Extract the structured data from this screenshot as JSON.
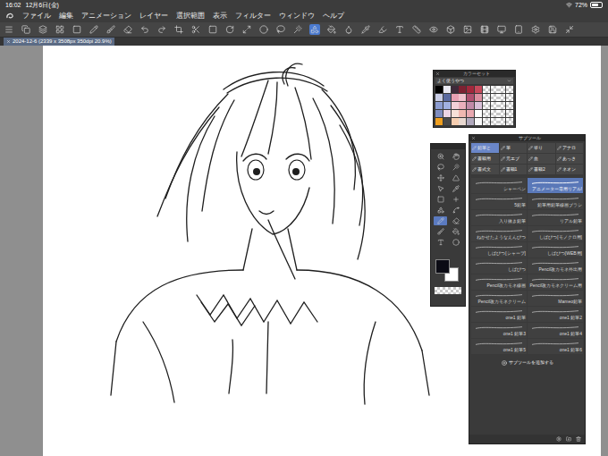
{
  "status_bar": {
    "time": "16:02",
    "date": "12月6日(金)",
    "battery": "72%",
    "battery_level": 0.72
  },
  "menu": [
    "ファイル",
    "編集",
    "アニメーション",
    "レイヤー",
    "選択範囲",
    "表示",
    "フィルター",
    "ウィンドウ",
    "ヘルプ"
  ],
  "toolbar": [
    {
      "selected": false
    },
    {
      "selected": false
    },
    {
      "selected": false
    },
    {
      "selected": false
    },
    {
      "selected": false
    },
    {
      "selected": false
    },
    {
      "selected": false
    },
    {
      "selected": false
    },
    {
      "selected": false
    },
    {
      "selected": false
    },
    {
      "selected": false
    },
    {
      "selected": false
    },
    {
      "selected": false
    },
    {
      "selected": false
    },
    {
      "selected": false
    },
    {
      "selected": false
    },
    {
      "selected": false
    },
    {
      "selected": false
    },
    {
      "selected": true
    },
    {
      "selected": false
    },
    {
      "selected": false
    },
    {
      "selected": false
    },
    {
      "selected": false
    },
    {
      "selected": false
    },
    {
      "selected": false
    },
    {
      "selected": false
    },
    {
      "selected": false
    },
    {
      "selected": false
    },
    {
      "selected": false
    },
    {
      "selected": false
    },
    {
      "selected": false
    },
    {
      "selected": false
    },
    {
      "selected": false
    },
    {
      "selected": false
    }
  ],
  "document_tab": {
    "label": "2024-12-6 (2339 x 3508px 350dpi 20.9%)",
    "selected": true
  },
  "color_set": {
    "title": "カラーセット",
    "set_name": "よく使うやつ",
    "swatches": [
      {
        "kind": "swatch",
        "color": "#000000"
      },
      {
        "kind": "swatch",
        "color": "#e9e9f2"
      },
      {
        "kind": "swatch",
        "color": "#3e2a3a"
      },
      {
        "kind": "swatch",
        "color": "#7d2232"
      },
      {
        "kind": "swatch",
        "color": "#a3283c"
      },
      {
        "kind": "swatch",
        "color": "#c74a5c"
      },
      {
        "kind": "empty"
      },
      {
        "kind": "empty"
      },
      {
        "kind": "empty"
      },
      {
        "kind": "empty"
      },
      {
        "kind": "swatch",
        "color": "#c9cde6"
      },
      {
        "kind": "swatch",
        "color": "#5a6aa0"
      },
      {
        "kind": "swatch",
        "color": "#e8a0b4"
      },
      {
        "kind": "swatch",
        "color": "#f0c0cc"
      },
      {
        "kind": "swatch",
        "color": "#b05070"
      },
      {
        "kind": "swatch",
        "color": "#dc8fa0"
      },
      {
        "kind": "empty"
      },
      {
        "kind": "empty"
      },
      {
        "kind": "empty"
      },
      {
        "kind": "empty"
      },
      {
        "kind": "swatch",
        "color": "#8c9cd0"
      },
      {
        "kind": "swatch",
        "color": "#a0b0e0"
      },
      {
        "kind": "swatch",
        "color": "#f3d0d8"
      },
      {
        "kind": "swatch",
        "color": "#e9b0bc"
      },
      {
        "kind": "swatch",
        "color": "#c08aa8"
      },
      {
        "kind": "swatch",
        "color": "#d8c0d8"
      },
      {
        "kind": "empty"
      },
      {
        "kind": "empty"
      },
      {
        "kind": "empty"
      },
      {
        "kind": "empty"
      },
      {
        "kind": "swatch",
        "color": "#7f8dc0"
      },
      {
        "kind": "swatch",
        "color": "#ecd5e6"
      },
      {
        "kind": "swatch",
        "color": "#f7e0d8"
      },
      {
        "kind": "swatch",
        "color": "#f0b8b0"
      },
      {
        "kind": "swatch",
        "color": "#e8a8b0"
      },
      {
        "kind": "swatch",
        "color": "#ffffff"
      },
      {
        "kind": "empty"
      },
      {
        "kind": "empty"
      },
      {
        "kind": "empty"
      },
      {
        "kind": "empty"
      },
      {
        "kind": "swatch",
        "color": "#f0a020"
      },
      {
        "kind": "swatch",
        "color": "#4a4a4a"
      },
      {
        "kind": "swatch",
        "color": "#f5cdb0"
      },
      {
        "kind": "swatch",
        "color": "#e8d8d0"
      },
      {
        "kind": "swatch",
        "color": "#b0a8bc"
      },
      {
        "kind": "swatch",
        "color": "#f8f8f8"
      },
      {
        "kind": "empty"
      },
      {
        "kind": "empty"
      },
      {
        "kind": "empty"
      },
      {
        "kind": "empty"
      }
    ]
  },
  "tool_palette": {
    "tools": [
      {
        "selected": false
      },
      {
        "selected": false
      },
      {
        "selected": false
      },
      {
        "selected": false
      },
      {
        "selected": false
      },
      {
        "selected": false
      },
      {
        "selected": false
      },
      {
        "selected": false
      },
      {
        "selected": false
      },
      {
        "selected": false
      },
      {
        "selected": false
      },
      {
        "selected": false
      },
      {
        "selected": true
      },
      {
        "selected": false
      },
      {
        "selected": false
      },
      {
        "selected": false
      },
      {
        "selected": false
      },
      {
        "selected": false
      }
    ],
    "main_color": "#0b0b14",
    "sub_color": "#ffffff"
  },
  "sub_tool": {
    "title": "サブツール",
    "groups": [
      {
        "label": "鉛筆と",
        "selected": true
      },
      {
        "label": "筆",
        "selected": false
      },
      {
        "label": "塗り",
        "selected": false
      },
      {
        "label": "アナロ",
        "selected": false
      },
      {
        "label": "書籍用",
        "selected": false
      },
      {
        "label": "元エブ",
        "selected": false
      },
      {
        "label": "血",
        "selected": false
      },
      {
        "label": "あっさ",
        "selected": false
      },
      {
        "label": "書式文",
        "selected": false
      },
      {
        "label": "書籍1",
        "selected": false
      },
      {
        "label": "書籍2",
        "selected": false
      },
      {
        "label": "ネオン",
        "selected": false
      }
    ],
    "items": [
      {
        "label": "シャーペン",
        "selected": false
      },
      {
        "label": "アニメーター専用リアル!",
        "selected": true
      },
      {
        "label": "5鉛筆",
        "selected": false
      },
      {
        "label": "鉛筆用鉛筆線画ブラシ",
        "selected": false
      },
      {
        "label": "入り抜き鉛筆",
        "selected": false
      },
      {
        "label": "リアル鉛筆",
        "selected": false
      },
      {
        "label": "ねかせたようなえんぴつ",
        "selected": false
      },
      {
        "label": "しばぴつ[モノクロ用]",
        "selected": false
      },
      {
        "label": "しばぴつ[シャープ]",
        "selected": false
      },
      {
        "label": "しばぴつ[WEB用]",
        "selected": false
      },
      {
        "label": "しばぴつ",
        "selected": false
      },
      {
        "label": "Pencil改カモネ外出用",
        "selected": false
      },
      {
        "label": "Pencil改カモネ線画",
        "selected": false
      },
      {
        "label": "Pencil改カモネクリーム用",
        "selected": false
      },
      {
        "label": "Pencil改カモネクリーム",
        "selected": false
      },
      {
        "label": "Mameo鉛筆",
        "selected": false
      },
      {
        "label": "one1 鉛筆",
        "selected": false
      },
      {
        "label": "one1 鉛筆2",
        "selected": false
      },
      {
        "label": "one1 鉛筆3",
        "selected": false
      },
      {
        "label": "one1 鉛筆4",
        "selected": false
      },
      {
        "label": "one1 鉛筆5",
        "selected": false
      },
      {
        "label": "one1 鉛筆6",
        "selected": false
      }
    ],
    "add_button": "サブツールを追加する"
  }
}
